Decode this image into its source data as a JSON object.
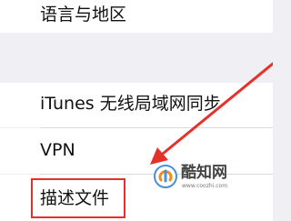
{
  "settings": {
    "items": [
      {
        "label": "语言与地区"
      },
      {
        "label": "iTunes 无线局域网同步"
      },
      {
        "label": "VPN"
      },
      {
        "label": "描述文件"
      }
    ]
  },
  "watermark": {
    "title": "酷知网",
    "url": "www.coozhi.com"
  },
  "colors": {
    "annotation": "#e6302a",
    "background": "#efeff4",
    "row": "#ffffff",
    "divider": "#d9d9de"
  }
}
